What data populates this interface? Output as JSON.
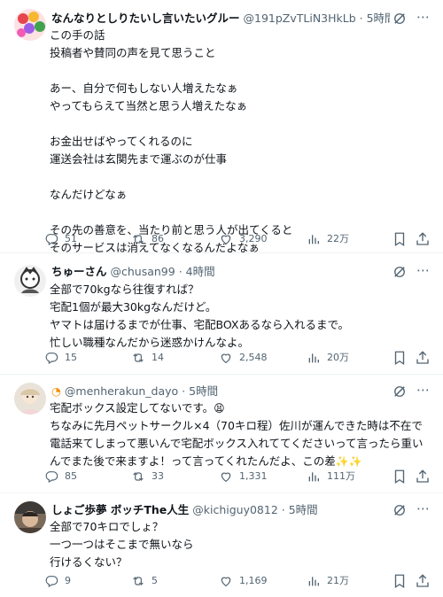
{
  "posts": [
    {
      "display_name": "なんなりとしりたいし言いたいグルー",
      "handle": "@191pZvTLiN3HkLb",
      "time": "5時間",
      "text": "この手の話\n投稿者や賛同の声を見て思うこと\n\nあー、自分で何もしない人増えたなぁ\nやってもらえて当然と思う人増えたなぁ\n\nお金出せばやってくれるのに\n運送会社は玄関先まで運ぶのが仕事\n\nなんだけどなぁ\n\nその先の善意を、当たり前と思う人が出てくると\nそのサービスは消えてなくなるんだよなぁ",
      "replies": "51",
      "reposts": "86",
      "likes": "3,290",
      "views": "22万"
    },
    {
      "display_name": "ちゅーさん",
      "handle": "@chusan99",
      "time": "4時間",
      "text": "全部で70kgなら往復すれば？\n宅配1個が最大30kgなんだけど。\nヤマトは届けるまでが仕事、宅配BOXあるなら入れるまで。\n忙しい職種なんだから迷惑かけんなよ。",
      "replies": "15",
      "reposts": "14",
      "likes": "2,548",
      "views": "20万"
    },
    {
      "display_name": "",
      "handle": "@menherakun_dayo",
      "time": "5時間",
      "text_line1": "宅配ボックス設定してないです。",
      "emoji1": "😫",
      "text_rest": "ちなみに先月ペットサークル×4（70キロ程）佐川が運んできた時は不在で電話来てしまって悪いんで宅配ボックス入れててくださいって言ったら重いんでまた後で来ますよ！って言ってくれたんだよ、この差",
      "emoji2": "✨✨",
      "replies": "85",
      "reposts": "33",
      "likes": "1,331",
      "views": "111万"
    },
    {
      "display_name": "しょご歩夢 ボッチThe人生",
      "handle": "@kichiguy0812",
      "time": "5時間",
      "text": "全部で70キロでしょ？\n一つ一つはそこまで無いなら\n行けるくない？",
      "replies": "9",
      "reposts": "5",
      "likes": "1,169",
      "views": "21万"
    }
  ],
  "icons": {
    "reply": "reply-icon",
    "repost": "repost-icon",
    "like": "heart-icon",
    "views": "views-icon",
    "bookmark": "bookmark-icon",
    "share": "share-icon",
    "grok": "grok-icon",
    "more": "more-icon"
  },
  "colors": {
    "text": "#0f1419",
    "muted": "#536471",
    "divider": "#eff3f4",
    "orange": "#f4900c"
  }
}
